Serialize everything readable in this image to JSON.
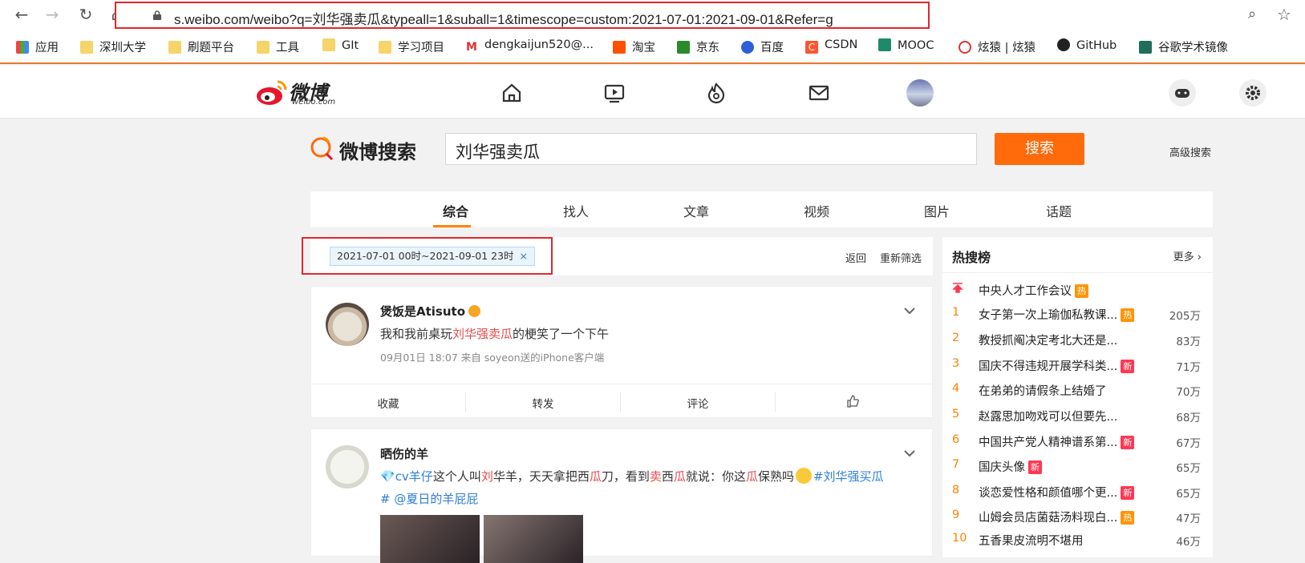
{
  "browser": {
    "url": "s.weibo.com/weibo?q=刘华强卖瓜&typeall=1&suball=1&timescope=custom:2021-07-01:2021-09-01&Refer=g",
    "bookmarks": [
      "应用",
      "深圳大学",
      "刷题平台",
      "工具",
      "GIt",
      "学习项目",
      "dengkaijun520@...",
      "淘宝",
      "京东",
      "百度",
      "CSDN",
      "MOOC",
      "炫猿 | 炫猿",
      "GitHub",
      "谷歌学术镜像"
    ]
  },
  "weibo": {
    "logo_text": "微博",
    "logo_sub": "weibo.com",
    "search_logo": "微博搜索",
    "search_value": "刘华强卖瓜",
    "search_button": "搜索",
    "advanced": "高级搜索",
    "tabs": [
      "综合",
      "找人",
      "文章",
      "视频",
      "图片",
      "话题"
    ],
    "filter_chip": "2021-07-01 00时~2021-09-01 23时",
    "filter_close": "×",
    "back": "返回",
    "refilter": "重新筛选"
  },
  "posts": [
    {
      "name": "煲饭是Atisuto",
      "text_before": "我和我前桌玩",
      "text_highlight": "刘华强卖瓜",
      "text_after": "的梗笑了一个下午",
      "meta": "09月01日 18:07  来自 soyeon送的iPhone客户端",
      "actions": [
        "收藏",
        "转发",
        "评论"
      ]
    },
    {
      "name": "晒伤的羊",
      "line1": {
        "mention": "cv羊仔",
        "t1": "这个人叫",
        "h1": "刘",
        "t2": "华羊，天天拿把西",
        "h2": "瓜",
        "t3": "刀，看到",
        "h3": "卖",
        "t4": "西",
        "h4": "瓜",
        "t5": "就说：你这",
        "h5": "瓜",
        "t6": "保熟吗",
        "tag": "#刘华强买瓜"
      },
      "line2": "# @夏日的羊屁屁"
    }
  ],
  "hot": {
    "title": "热搜榜",
    "more": "更多",
    "items": [
      {
        "rank": "",
        "title": "中央人才工作会议",
        "badge": "热",
        "badge_color": "#ff9406",
        "count": ""
      },
      {
        "rank": "1",
        "title": "女子第一次上瑜伽私教课...",
        "badge": "热",
        "badge_color": "#ff9406",
        "count": "205万"
      },
      {
        "rank": "2",
        "title": "教授抓阄决定考北大还是...",
        "badge": "",
        "badge_color": "",
        "count": "83万"
      },
      {
        "rank": "3",
        "title": "国庆不得违规开展学科类...",
        "badge": "新",
        "badge_color": "#ff3852",
        "count": "71万"
      },
      {
        "rank": "4",
        "title": "在弟弟的请假条上结婚了",
        "badge": "",
        "badge_color": "",
        "count": "70万"
      },
      {
        "rank": "5",
        "title": "赵露思加吻戏可以但要先...",
        "badge": "",
        "badge_color": "",
        "count": "68万"
      },
      {
        "rank": "6",
        "title": "中国共产党人精神谱系第...",
        "badge": "新",
        "badge_color": "#ff3852",
        "count": "67万"
      },
      {
        "rank": "7",
        "title": "国庆头像",
        "badge": "新",
        "badge_color": "#ff3852",
        "count": "65万"
      },
      {
        "rank": "8",
        "title": "谈恋爱性格和颜值哪个更...",
        "badge": "新",
        "badge_color": "#ff3852",
        "count": "65万"
      },
      {
        "rank": "9",
        "title": "山姆会员店菌菇汤料现白...",
        "badge": "热",
        "badge_color": "#ff9406",
        "count": "47万"
      },
      {
        "rank": "10",
        "title": "五香果皮流明不堪用",
        "badge": "",
        "badge_color": "",
        "count": "46万"
      }
    ]
  }
}
